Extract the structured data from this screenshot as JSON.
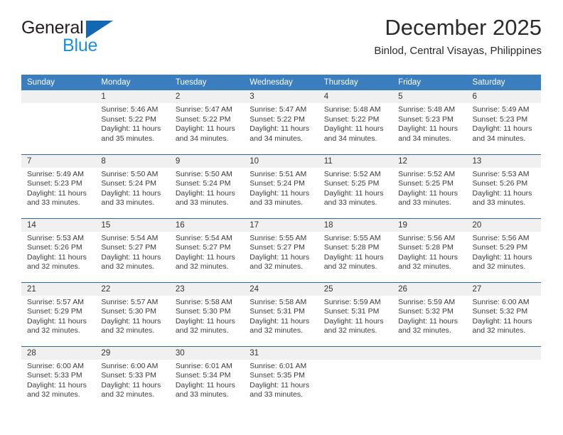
{
  "brand": {
    "line1": "General",
    "line2": "Blue",
    "triangle_color": "#1268b3",
    "blue_text_color": "#1f8fdc"
  },
  "header": {
    "title": "December 2025",
    "subtitle": "Binlod, Central Visayas, Philippines"
  },
  "theme": {
    "header_bg": "#3a7ebf",
    "row_rule": "#2b6ca3",
    "daynum_band": "#f0f0f0"
  },
  "weekday_headers": [
    "Sunday",
    "Monday",
    "Tuesday",
    "Wednesday",
    "Thursday",
    "Friday",
    "Saturday"
  ],
  "weeks": [
    [
      {
        "day": ""
      },
      {
        "day": "1",
        "sunrise": "Sunrise: 5:46 AM",
        "sunset": "Sunset: 5:22 PM",
        "daylight1": "Daylight: 11 hours",
        "daylight2": "and 35 minutes."
      },
      {
        "day": "2",
        "sunrise": "Sunrise: 5:47 AM",
        "sunset": "Sunset: 5:22 PM",
        "daylight1": "Daylight: 11 hours",
        "daylight2": "and 34 minutes."
      },
      {
        "day": "3",
        "sunrise": "Sunrise: 5:47 AM",
        "sunset": "Sunset: 5:22 PM",
        "daylight1": "Daylight: 11 hours",
        "daylight2": "and 34 minutes."
      },
      {
        "day": "4",
        "sunrise": "Sunrise: 5:48 AM",
        "sunset": "Sunset: 5:22 PM",
        "daylight1": "Daylight: 11 hours",
        "daylight2": "and 34 minutes."
      },
      {
        "day": "5",
        "sunrise": "Sunrise: 5:48 AM",
        "sunset": "Sunset: 5:23 PM",
        "daylight1": "Daylight: 11 hours",
        "daylight2": "and 34 minutes."
      },
      {
        "day": "6",
        "sunrise": "Sunrise: 5:49 AM",
        "sunset": "Sunset: 5:23 PM",
        "daylight1": "Daylight: 11 hours",
        "daylight2": "and 34 minutes."
      }
    ],
    [
      {
        "day": "7",
        "sunrise": "Sunrise: 5:49 AM",
        "sunset": "Sunset: 5:23 PM",
        "daylight1": "Daylight: 11 hours",
        "daylight2": "and 33 minutes."
      },
      {
        "day": "8",
        "sunrise": "Sunrise: 5:50 AM",
        "sunset": "Sunset: 5:24 PM",
        "daylight1": "Daylight: 11 hours",
        "daylight2": "and 33 minutes."
      },
      {
        "day": "9",
        "sunrise": "Sunrise: 5:50 AM",
        "sunset": "Sunset: 5:24 PM",
        "daylight1": "Daylight: 11 hours",
        "daylight2": "and 33 minutes."
      },
      {
        "day": "10",
        "sunrise": "Sunrise: 5:51 AM",
        "sunset": "Sunset: 5:24 PM",
        "daylight1": "Daylight: 11 hours",
        "daylight2": "and 33 minutes."
      },
      {
        "day": "11",
        "sunrise": "Sunrise: 5:52 AM",
        "sunset": "Sunset: 5:25 PM",
        "daylight1": "Daylight: 11 hours",
        "daylight2": "and 33 minutes."
      },
      {
        "day": "12",
        "sunrise": "Sunrise: 5:52 AM",
        "sunset": "Sunset: 5:25 PM",
        "daylight1": "Daylight: 11 hours",
        "daylight2": "and 33 minutes."
      },
      {
        "day": "13",
        "sunrise": "Sunrise: 5:53 AM",
        "sunset": "Sunset: 5:26 PM",
        "daylight1": "Daylight: 11 hours",
        "daylight2": "and 33 minutes."
      }
    ],
    [
      {
        "day": "14",
        "sunrise": "Sunrise: 5:53 AM",
        "sunset": "Sunset: 5:26 PM",
        "daylight1": "Daylight: 11 hours",
        "daylight2": "and 32 minutes."
      },
      {
        "day": "15",
        "sunrise": "Sunrise: 5:54 AM",
        "sunset": "Sunset: 5:27 PM",
        "daylight1": "Daylight: 11 hours",
        "daylight2": "and 32 minutes."
      },
      {
        "day": "16",
        "sunrise": "Sunrise: 5:54 AM",
        "sunset": "Sunset: 5:27 PM",
        "daylight1": "Daylight: 11 hours",
        "daylight2": "and 32 minutes."
      },
      {
        "day": "17",
        "sunrise": "Sunrise: 5:55 AM",
        "sunset": "Sunset: 5:27 PM",
        "daylight1": "Daylight: 11 hours",
        "daylight2": "and 32 minutes."
      },
      {
        "day": "18",
        "sunrise": "Sunrise: 5:55 AM",
        "sunset": "Sunset: 5:28 PM",
        "daylight1": "Daylight: 11 hours",
        "daylight2": "and 32 minutes."
      },
      {
        "day": "19",
        "sunrise": "Sunrise: 5:56 AM",
        "sunset": "Sunset: 5:28 PM",
        "daylight1": "Daylight: 11 hours",
        "daylight2": "and 32 minutes."
      },
      {
        "day": "20",
        "sunrise": "Sunrise: 5:56 AM",
        "sunset": "Sunset: 5:29 PM",
        "daylight1": "Daylight: 11 hours",
        "daylight2": "and 32 minutes."
      }
    ],
    [
      {
        "day": "21",
        "sunrise": "Sunrise: 5:57 AM",
        "sunset": "Sunset: 5:29 PM",
        "daylight1": "Daylight: 11 hours",
        "daylight2": "and 32 minutes."
      },
      {
        "day": "22",
        "sunrise": "Sunrise: 5:57 AM",
        "sunset": "Sunset: 5:30 PM",
        "daylight1": "Daylight: 11 hours",
        "daylight2": "and 32 minutes."
      },
      {
        "day": "23",
        "sunrise": "Sunrise: 5:58 AM",
        "sunset": "Sunset: 5:30 PM",
        "daylight1": "Daylight: 11 hours",
        "daylight2": "and 32 minutes."
      },
      {
        "day": "24",
        "sunrise": "Sunrise: 5:58 AM",
        "sunset": "Sunset: 5:31 PM",
        "daylight1": "Daylight: 11 hours",
        "daylight2": "and 32 minutes."
      },
      {
        "day": "25",
        "sunrise": "Sunrise: 5:59 AM",
        "sunset": "Sunset: 5:31 PM",
        "daylight1": "Daylight: 11 hours",
        "daylight2": "and 32 minutes."
      },
      {
        "day": "26",
        "sunrise": "Sunrise: 5:59 AM",
        "sunset": "Sunset: 5:32 PM",
        "daylight1": "Daylight: 11 hours",
        "daylight2": "and 32 minutes."
      },
      {
        "day": "27",
        "sunrise": "Sunrise: 6:00 AM",
        "sunset": "Sunset: 5:32 PM",
        "daylight1": "Daylight: 11 hours",
        "daylight2": "and 32 minutes."
      }
    ],
    [
      {
        "day": "28",
        "sunrise": "Sunrise: 6:00 AM",
        "sunset": "Sunset: 5:33 PM",
        "daylight1": "Daylight: 11 hours",
        "daylight2": "and 32 minutes."
      },
      {
        "day": "29",
        "sunrise": "Sunrise: 6:00 AM",
        "sunset": "Sunset: 5:33 PM",
        "daylight1": "Daylight: 11 hours",
        "daylight2": "and 32 minutes."
      },
      {
        "day": "30",
        "sunrise": "Sunrise: 6:01 AM",
        "sunset": "Sunset: 5:34 PM",
        "daylight1": "Daylight: 11 hours",
        "daylight2": "and 33 minutes."
      },
      {
        "day": "31",
        "sunrise": "Sunrise: 6:01 AM",
        "sunset": "Sunset: 5:35 PM",
        "daylight1": "Daylight: 11 hours",
        "daylight2": "and 33 minutes."
      },
      {
        "day": ""
      },
      {
        "day": ""
      },
      {
        "day": ""
      }
    ]
  ]
}
